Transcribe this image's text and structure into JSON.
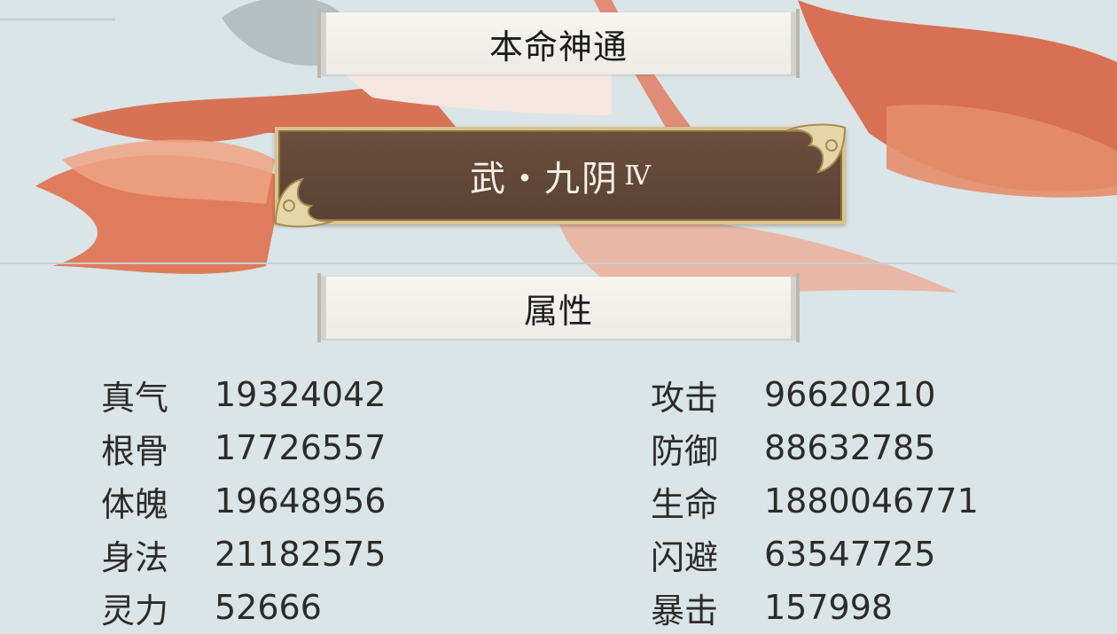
{
  "banners": {
    "top_title": "本命神通",
    "attr_title": "属性"
  },
  "skill": {
    "name": "武・九阴",
    "rank": "Ⅳ"
  },
  "stats_left": [
    {
      "label": "真气",
      "value": "19324042"
    },
    {
      "label": "根骨",
      "value": "17726557"
    },
    {
      "label": "体魄",
      "value": "19648956"
    },
    {
      "label": "身法",
      "value": "21182575"
    },
    {
      "label": "灵力",
      "value": "52666"
    }
  ],
  "stats_right": [
    {
      "label": "攻击",
      "value": "96620210"
    },
    {
      "label": "防御",
      "value": "88632785"
    },
    {
      "label": "生命",
      "value": "1880046771"
    },
    {
      "label": "闪避",
      "value": "63547725"
    },
    {
      "label": "暴击",
      "value": "157998"
    }
  ],
  "colors": {
    "background": "#dbe4e6",
    "plate": "#5e4536",
    "plate_border": "#d8c48a",
    "art_red": "#d96a4f"
  }
}
